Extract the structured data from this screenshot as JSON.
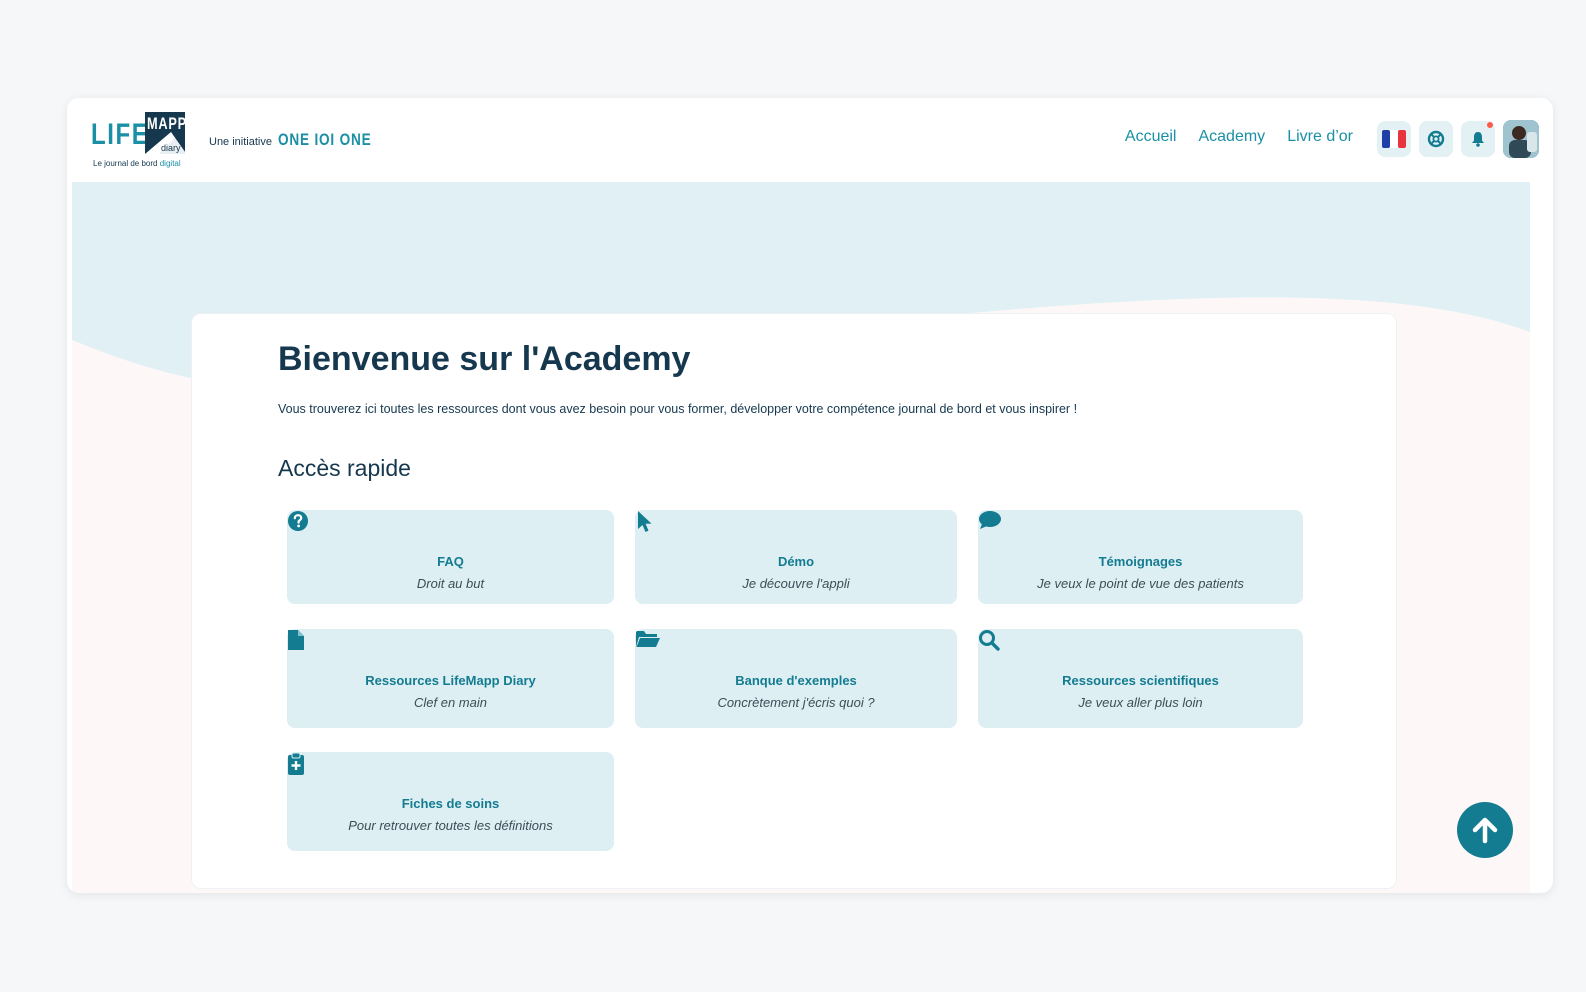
{
  "brand": {
    "logo_life": "LIFE",
    "logo_mapp": "MAPP",
    "logo_diary": "diary",
    "logo_tagline_prefix": "Le journal de bord",
    "logo_tagline_accent": "digital",
    "initiative_label": "Une initiative",
    "initiative_brand": "ONE IOI ONE"
  },
  "nav": {
    "items": [
      {
        "label": "Accueil"
      },
      {
        "label": "Academy"
      },
      {
        "label": "Livre d’or"
      }
    ]
  },
  "toolbar": {
    "language_icon": "france-flag-icon",
    "help_icon": "lifebuoy-icon",
    "notifications_icon": "bell-icon",
    "has_unread_notifications": true
  },
  "main": {
    "title": "Bienvenue sur l'Academy",
    "intro": "Vous trouverez ici toutes les ressources dont vous avez besoin pour vous former, développer votre compétence journal de bord et vous inspirer !",
    "section_title": "Accès rapide",
    "tiles": [
      {
        "title": "FAQ",
        "subtitle": "Droit au but",
        "icon": "question-circle-icon"
      },
      {
        "title": "Démo",
        "subtitle": "Je découvre l'appli",
        "icon": "cursor-icon"
      },
      {
        "title": "Témoignages",
        "subtitle": "Je veux le point de vue des patients",
        "icon": "comment-icon"
      },
      {
        "title": "Ressources LifeMapp Diary",
        "subtitle": "Clef en main",
        "icon": "file-icon"
      },
      {
        "title": "Banque d'exemples",
        "subtitle": "Concrètement j'écris quoi ?",
        "icon": "folder-open-icon"
      },
      {
        "title": "Ressources scientifiques",
        "subtitle": "Je veux aller plus loin",
        "icon": "search-icon"
      },
      {
        "title": "Fiches de soins",
        "subtitle": "Pour retrouver toutes les définitions",
        "icon": "clipboard-medical-icon"
      }
    ]
  },
  "colors": {
    "accent": "#137c91",
    "accent_light": "#1b8fa5",
    "tile_bg": "#ddeff3",
    "heading": "#16384f",
    "notification_dot": "#ff5a4a"
  },
  "scroll_top_icon": "arrow-up-icon"
}
